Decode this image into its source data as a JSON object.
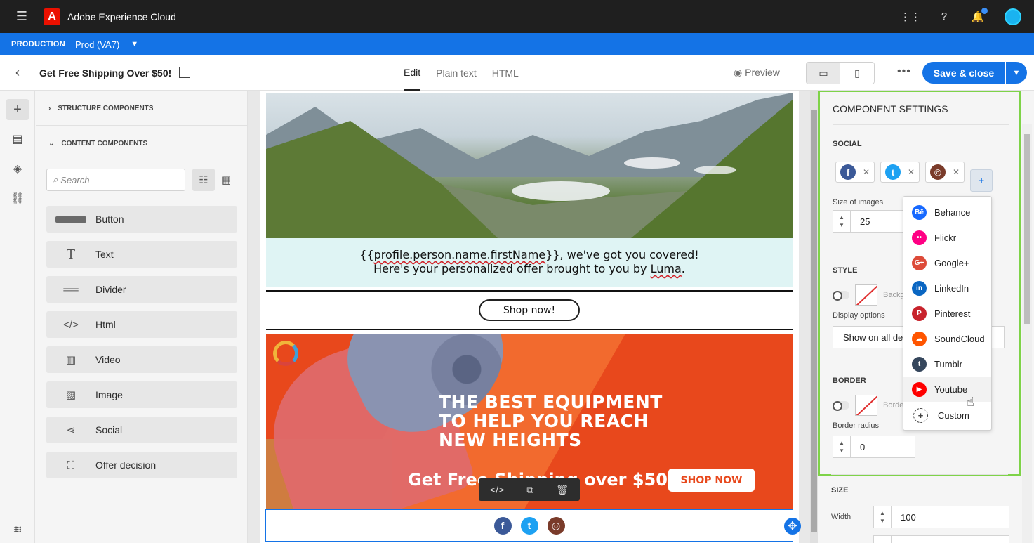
{
  "app": {
    "title": "Adobe Experience Cloud"
  },
  "env": {
    "label": "PRODUCTION",
    "value": "Prod (VA7)"
  },
  "toolbar": {
    "doc_title": "Get Free Shipping Over $50!",
    "tabs": [
      "Edit",
      "Plain text",
      "HTML"
    ],
    "active_tab": "Edit",
    "preview_label": "Preview",
    "save_label": "Save & close"
  },
  "components": {
    "structure_header": "STRUCTURE COMPONENTS",
    "content_header": "CONTENT COMPONENTS",
    "search_placeholder": "Search",
    "items": [
      {
        "label": "Button",
        "icon": "button-icon"
      },
      {
        "label": "Text",
        "icon": "text-icon"
      },
      {
        "label": "Divider",
        "icon": "divider-icon"
      },
      {
        "label": "Html",
        "icon": "code-icon"
      },
      {
        "label": "Video",
        "icon": "film-icon"
      },
      {
        "label": "Image",
        "icon": "image-icon"
      },
      {
        "label": "Social",
        "icon": "share-icon"
      },
      {
        "label": "Offer decision",
        "icon": "offer-icon"
      }
    ]
  },
  "email": {
    "greeting_line1_pre": "{{",
    "greeting_line1_var": "profile.person.name.firstName",
    "greeting_line1_post": "}}, we've got you covered!",
    "greeting_line2_pre": "Here's your personalized offer brought to you by ",
    "greeting_line2_brand": "Luma",
    "greeting_line2_post": ".",
    "shop_button": "Shop now!",
    "promo_headline_1": "THE BEST EQUIPMENT",
    "promo_headline_2": "TO HELP YOU REACH",
    "promo_headline_3": "NEW HEIGHTS",
    "promo_subline": "Get Free Shipping over $50",
    "promo_cta": "SHOP NOW"
  },
  "settings": {
    "title": "COMPONENT SETTINGS",
    "social_header": "SOCIAL",
    "size_of_images_label": "Size of images",
    "size_of_images_value": "25",
    "style_header": "STYLE",
    "background_label": "Backg",
    "display_options_label": "Display options",
    "display_options_value": "Show on all de",
    "border_header": "BORDER",
    "border_label": "Borde",
    "border_radius_label": "Border radius",
    "border_radius_value": "0",
    "size_header": "SIZE",
    "width_label": "Width",
    "width_value": "100"
  },
  "social_menu": {
    "items": [
      {
        "label": "Behance",
        "color": "#1769ff"
      },
      {
        "label": "Flickr",
        "color": "#ff0084"
      },
      {
        "label": "Google+",
        "color": "#dd4b39"
      },
      {
        "label": "LinkedIn",
        "color": "#0a66c2"
      },
      {
        "label": "Pinterest",
        "color": "#c8232c"
      },
      {
        "label": "SoundCloud",
        "color": "#ff5500"
      },
      {
        "label": "Tumblr",
        "color": "#35465c"
      },
      {
        "label": "Youtube",
        "color": "#ff0000"
      },
      {
        "label": "Custom",
        "color": "#444444"
      }
    ],
    "hovered": "Youtube"
  },
  "colors": {
    "accent": "#1473e6",
    "selection_outline": "#7ed348",
    "facebook": "#3b5998",
    "twitter": "#1da1f2",
    "instagram": "#8a3a2a"
  }
}
